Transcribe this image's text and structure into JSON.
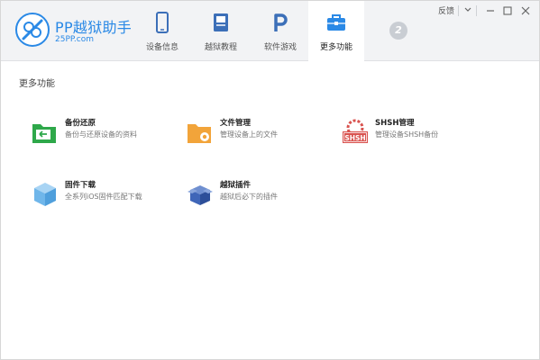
{
  "app": {
    "title": "PP越狱助手",
    "subtitle": "25PP.com"
  },
  "tabs": [
    {
      "label": "设备信息",
      "icon": "phone-icon"
    },
    {
      "label": "越狱教程",
      "icon": "book-icon"
    },
    {
      "label": "软件游戏",
      "icon": "pp-app-icon"
    },
    {
      "label": "更多功能",
      "icon": "toolbox-icon",
      "active": true
    }
  ],
  "device_badge": {
    "icon": "device-count-icon",
    "text": "2"
  },
  "window_controls": {
    "feedback_label": "反馈"
  },
  "main": {
    "section_title": "更多功能",
    "features": [
      {
        "title": "备份还原",
        "desc": "备份与还原设备的资料",
        "icon": "folder-restore-icon"
      },
      {
        "title": "文件管理",
        "desc": "管理设备上的文件",
        "icon": "folder-settings-icon"
      },
      {
        "title": "SHSH管理",
        "desc": "管理设备SHSH备份",
        "icon": "shsh-gear-icon",
        "badge_text": "SHSH"
      },
      {
        "title": "固件下载",
        "desc": "全系列iOS固件匹配下载",
        "icon": "firmware-cube-icon"
      },
      {
        "title": "越狱插件",
        "desc": "越狱后必下的插件",
        "icon": "plugin-boxes-icon"
      }
    ]
  },
  "colors": {
    "brand_blue": "#2a89e6",
    "green": "#2ea84a",
    "orange": "#f2a43a",
    "red": "#d9534f",
    "cube_blue": "#6fb6ea",
    "plugin_blue": "#3f66b8"
  }
}
